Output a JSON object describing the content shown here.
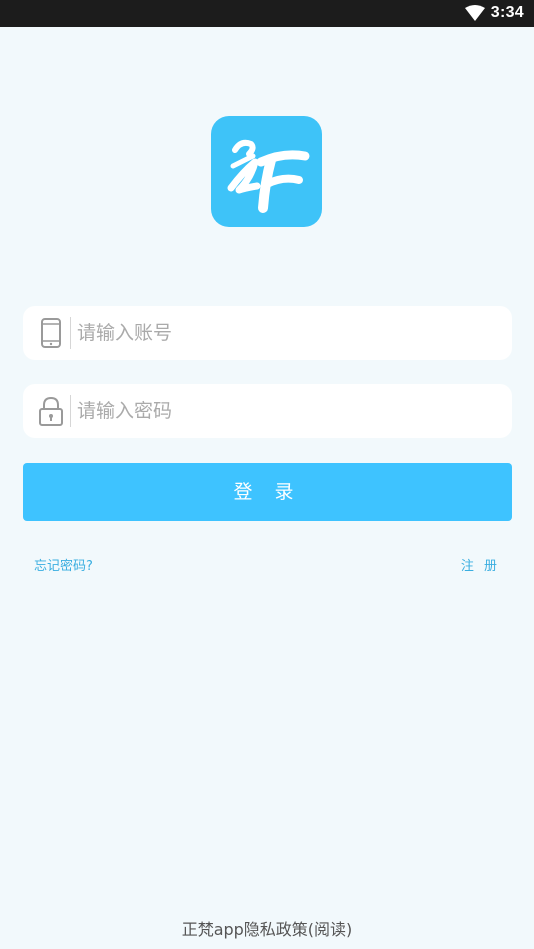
{
  "status_bar": {
    "time": "3:34",
    "wifi_icon": "wifi-icon"
  },
  "logo": {
    "icon": "app-logo-icon",
    "color": "#3ec3f8"
  },
  "form": {
    "account": {
      "icon": "phone-icon",
      "placeholder": "请输入账号",
      "value": ""
    },
    "password": {
      "icon": "lock-icon",
      "placeholder": "请输入密码",
      "value": ""
    },
    "login_label": "登 录"
  },
  "links": {
    "forgot_password": "忘记密码?",
    "register": "注 册"
  },
  "footer": {
    "privacy": "正梵app隐私政策(阅读)"
  },
  "colors": {
    "accent": "#3ec3ff",
    "link": "#3aaee0",
    "background": "#f2f9fc"
  }
}
